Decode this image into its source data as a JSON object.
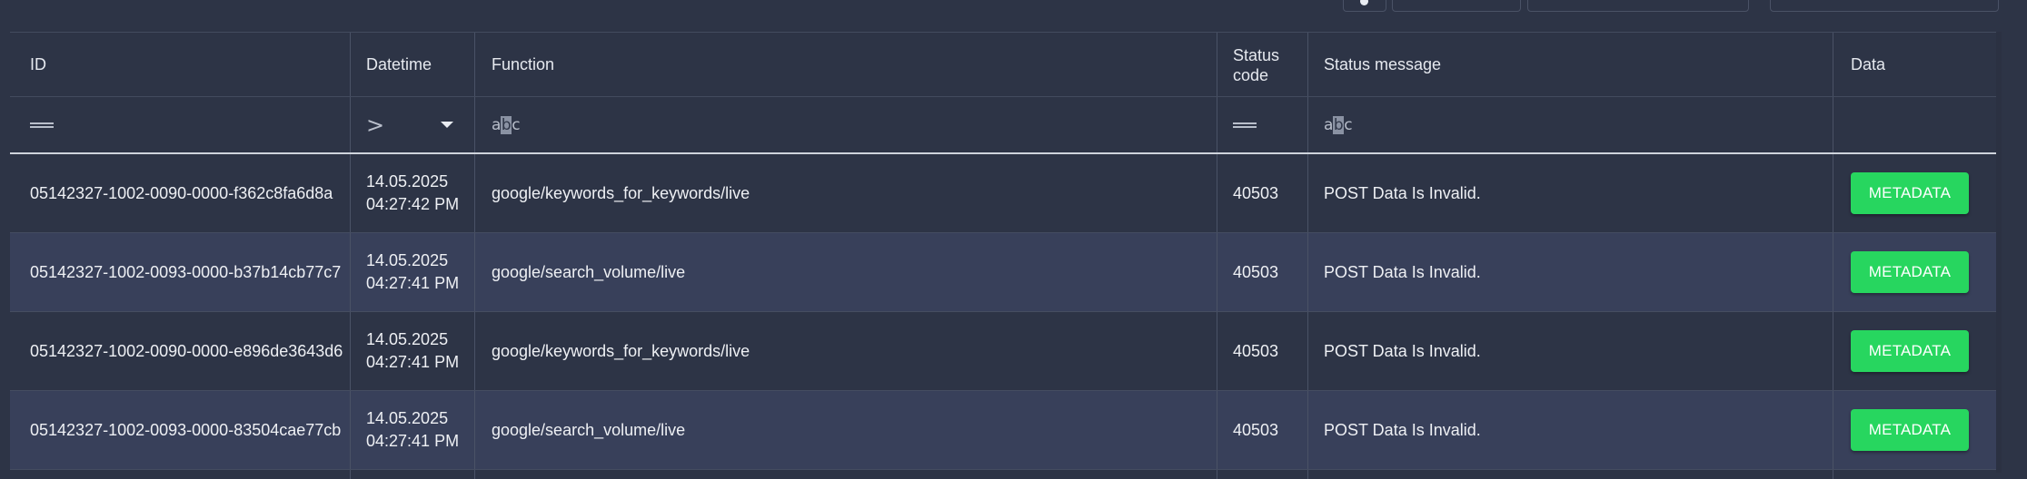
{
  "columns": {
    "id": "ID",
    "datetime": "Datetime",
    "function": "Function",
    "status_code_line1": "Status",
    "status_code_line2": "code",
    "status_message": "Status message",
    "data": "Data"
  },
  "filters": {
    "id_operator": "equals",
    "datetime_operator": ">",
    "function_operator": "contains",
    "status_code_operator": "equals",
    "status_message_operator": "contains"
  },
  "rows": [
    {
      "id": "05142327-1002-0090-0000-f362c8fa6d8a",
      "date": "14.05.2025",
      "time": "04:27:42 PM",
      "function": "google/keywords_for_keywords/live",
      "status_code": "40503",
      "status_message": "POST Data Is Invalid.",
      "button": "METADATA"
    },
    {
      "id": "05142327-1002-0093-0000-b37b14cb77c7",
      "date": "14.05.2025",
      "time": "04:27:41 PM",
      "function": "google/search_volume/live",
      "status_code": "40503",
      "status_message": "POST Data Is Invalid.",
      "button": "METADATA"
    },
    {
      "id": "05142327-1002-0090-0000-e896de3643d6",
      "date": "14.05.2025",
      "time": "04:27:41 PM",
      "function": "google/keywords_for_keywords/live",
      "status_code": "40503",
      "status_message": "POST Data Is Invalid.",
      "button": "METADATA"
    },
    {
      "id": "05142327-1002-0093-0000-83504cae77cb",
      "date": "14.05.2025",
      "time": "04:27:41 PM",
      "function": "google/search_volume/live",
      "status_code": "40503",
      "status_message": "POST Data Is Invalid.",
      "button": "METADATA"
    }
  ],
  "colors": {
    "background": "#2d3446",
    "row_alt": "#38405a",
    "button": "#27d65f"
  }
}
